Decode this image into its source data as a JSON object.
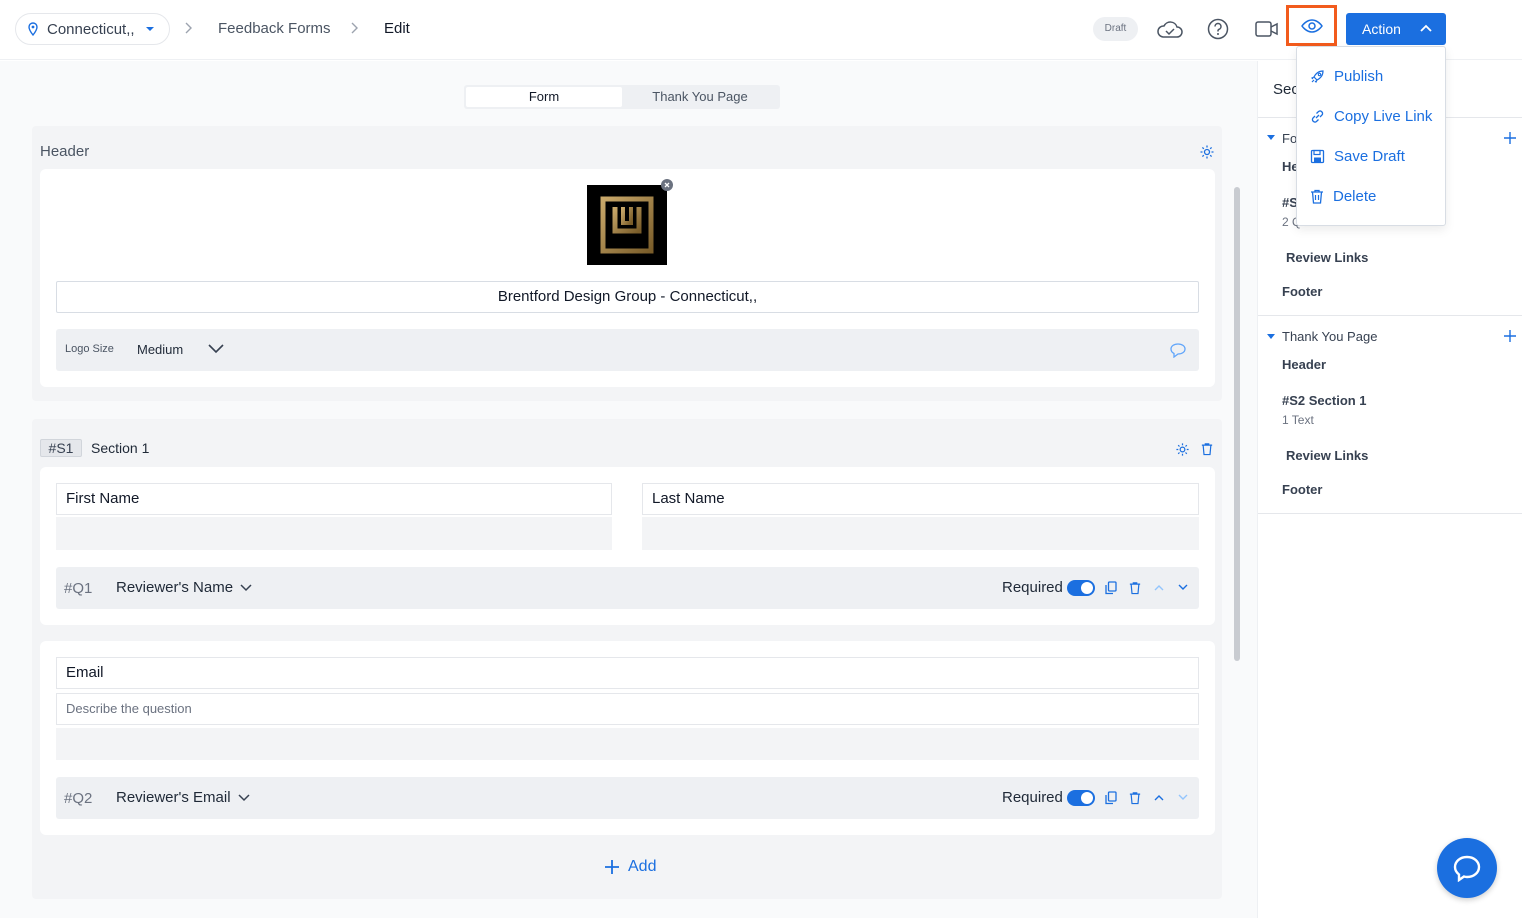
{
  "location": {
    "name": "Connecticut,,"
  },
  "breadcrumb": {
    "parent": "Feedback Forms",
    "current": "Edit"
  },
  "status_badge": "Draft",
  "action_button": {
    "label": "Action"
  },
  "action_menu": [
    {
      "label": "Publish",
      "icon": "rocket-icon"
    },
    {
      "label": "Copy Live Link",
      "icon": "link-icon"
    },
    {
      "label": "Save Draft",
      "icon": "save-icon"
    },
    {
      "label": "Delete",
      "icon": "trash-icon"
    }
  ],
  "tabs": {
    "active": "Form",
    "inactive": "Thank You Page"
  },
  "header_panel": {
    "title": "Header",
    "company_name": "Brentford Design Group - Connecticut,,",
    "logo_size_label": "Logo Size",
    "logo_size_value": "Medium"
  },
  "section1": {
    "tag": "#S1",
    "title": "Section 1",
    "first_name_label": "First Name",
    "last_name_label": "Last Name",
    "q1": {
      "num": "#Q1",
      "name": "Reviewer's Name",
      "required": "Required",
      "required_on": true
    },
    "email_label": "Email",
    "email_placeholder": "Describe the question",
    "q2": {
      "num": "#Q2",
      "name": "Reviewer's Email",
      "required": "Required",
      "required_on": true
    },
    "add_label": "Add"
  },
  "sidebar": {
    "title_partial": "Sec",
    "form_group": {
      "title_partial": "Fo",
      "header_partial": "He",
      "section_partial": "#S",
      "section_sub_partial": "2 Q",
      "review_links": "Review Links",
      "footer": "Footer"
    },
    "thank_you_group": {
      "title": "Thank You Page",
      "header": "Header",
      "section": "#S2 Section 1",
      "section_sub": "1 Text",
      "review_links": "Review Links",
      "footer": "Footer"
    }
  },
  "colors": {
    "accent": "#1b6fe0",
    "highlight": "#f25b1d"
  }
}
